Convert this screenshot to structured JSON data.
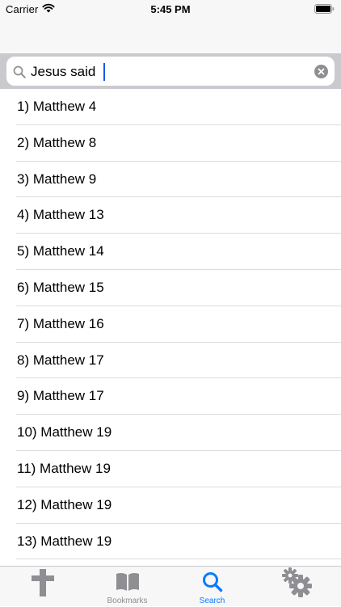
{
  "status_bar": {
    "carrier": "Carrier",
    "time": "5:45 PM"
  },
  "search": {
    "value": "Jesus said"
  },
  "results": [
    "1) Matthew 4",
    "2) Matthew 8",
    "3) Matthew 9",
    "4) Matthew 13",
    "5) Matthew 14",
    "6) Matthew 15",
    "7) Matthew 16",
    "8) Matthew 17",
    "9) Matthew 17",
    "10) Matthew 19",
    "11) Matthew 19",
    "12) Matthew 19",
    "13) Matthew 19"
  ],
  "tab_bar": {
    "items": [
      {
        "label": "",
        "icon": "cross-icon",
        "active": false
      },
      {
        "label": "Bookmarks",
        "icon": "book-icon",
        "active": false
      },
      {
        "label": "Search",
        "icon": "search-icon",
        "active": true
      },
      {
        "label": "",
        "icon": "gears-icon",
        "active": false
      }
    ]
  },
  "colors": {
    "accent": "#0a7aff",
    "inactive": "#8e8e93",
    "bar_background": "#f7f7f7",
    "search_background": "#c9c9ce"
  }
}
